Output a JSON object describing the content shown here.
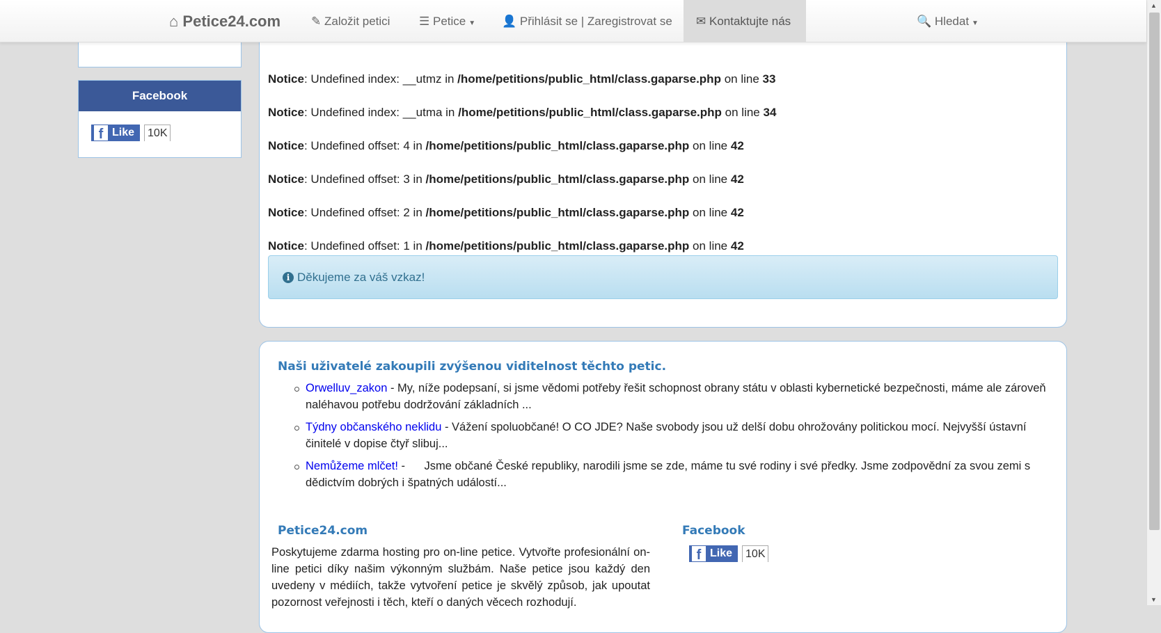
{
  "nav": {
    "brand": "Petice24.com",
    "create": "Založit petici",
    "petitions": "Petice",
    "login": "Přihlásit se | Zaregistrovat se",
    "contact": "Kontaktujte nás",
    "search": "Hledat"
  },
  "sidebar": {
    "facebook_title": "Facebook",
    "like": "Like",
    "like_count": "10K"
  },
  "notices": [
    {
      "label": "Notice",
      "msg": ": Undefined index: __utmz in ",
      "file": "/home/petitions/public_html/class.gaparse.php",
      "on": " on line ",
      "line": "33"
    },
    {
      "label": "Notice",
      "msg": ": Undefined index: __utma in ",
      "file": "/home/petitions/public_html/class.gaparse.php",
      "on": " on line ",
      "line": "34"
    },
    {
      "label": "Notice",
      "msg": ": Undefined offset: 4 in ",
      "file": "/home/petitions/public_html/class.gaparse.php",
      "on": " on line ",
      "line": "42"
    },
    {
      "label": "Notice",
      "msg": ": Undefined offset: 3 in ",
      "file": "/home/petitions/public_html/class.gaparse.php",
      "on": " on line ",
      "line": "42"
    },
    {
      "label": "Notice",
      "msg": ": Undefined offset: 2 in ",
      "file": "/home/petitions/public_html/class.gaparse.php",
      "on": " on line ",
      "line": "42"
    },
    {
      "label": "Notice",
      "msg": ": Undefined offset: 1 in ",
      "file": "/home/petitions/public_html/class.gaparse.php",
      "on": " on line ",
      "line": "42"
    }
  ],
  "alert": {
    "icon": "info-circle-icon",
    "text": "Děkujeme za váš vzkaz!"
  },
  "featured": {
    "title": "Naši uživatelé zakoupili zvýšenou viditelnost těchto petic.",
    "items": [
      {
        "link": "Orwelluv_zakon",
        "text": " - My, níže podepsaní, si jsme vědomi potřeby řešit schopnost obrany státu v oblasti kybernetické bezpečnosti, máme ale zároveň naléhavou potřebu dodržování základních ..."
      },
      {
        "link": "Týdny občanského neklidu",
        "text": " - Vážení spoluobčané! O CO JDE? Naše svobody jsou už delší dobu ohrožovány politickou mocí. Nejvyšší ústavní činitelé v dopise čtyř slibuj..."
      },
      {
        "link": "Nemůžeme mlčet!",
        "text": " -      Jsme občané České republiky, narodili jsme se zde, máme tu své rodiny i své předky. Jsme zodpovědní za svou zemi s dědictvím dobrých i špatných událostí..."
      }
    ]
  },
  "footer": {
    "about_title": "Petice24.com",
    "about_text": "Poskytujeme zdarma hosting pro on-line petice. Vytvořte profesionální on-line petici díky našim výkonným službám. Naše petice jsou každý den uvedeny v médiích, takže vytvoření petice je skvělý způsob, jak upoutat pozornost veřejnosti i těch, kteří o daných věcech rozhodují.",
    "facebook_title": "Facebook",
    "like": "Like",
    "like_count": "10K"
  },
  "colors": {
    "accent": "#337ab7",
    "facebook": "#3b5998",
    "alert_bg": "#d9edf7",
    "alert_text": "#31708f"
  }
}
